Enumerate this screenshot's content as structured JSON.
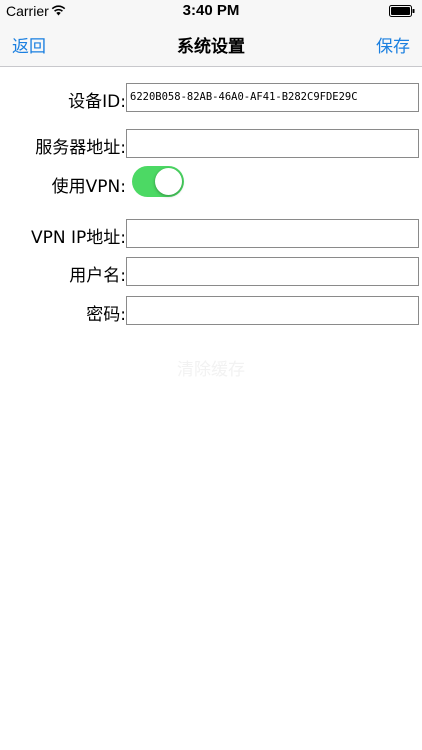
{
  "status_bar": {
    "carrier": "Carrier",
    "time": "3:40 PM",
    "icons": [
      "wifi-icon",
      "battery-icon"
    ]
  },
  "nav": {
    "back_label": "返回",
    "title": "系统设置",
    "save_label": "保存",
    "accent_color": "#1a7fe0"
  },
  "form": {
    "device_id_label": "设备ID:",
    "device_id_value": "6220B058-82AB-46A0-AF41-B282C9FDE29C",
    "server_address_label": "服务器地址:",
    "server_address_value": "",
    "use_vpn_label": "使用VPN:",
    "use_vpn_on": true,
    "vpn_ip_label": "VPN IP地址:",
    "vpn_ip_value": "",
    "username_label": "用户名:",
    "username_value": "",
    "password_label": "密码:",
    "password_value": ""
  },
  "clear_cache_label": "清除缓存",
  "colors": {
    "toggle_on": "#4cd964",
    "bar_background": "#f7f7f7"
  }
}
